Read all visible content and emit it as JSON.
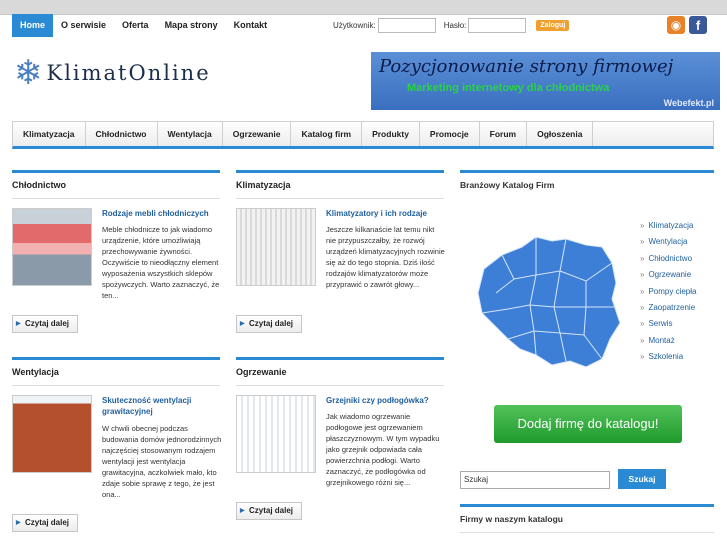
{
  "topnav": [
    {
      "label": "Home",
      "active": true
    },
    {
      "label": "O serwisie"
    },
    {
      "label": "Oferta"
    },
    {
      "label": "Mapa strony"
    },
    {
      "label": "Kontakt"
    }
  ],
  "login": {
    "user_label": "Użytkownik:",
    "pass_label": "Hasło:",
    "button": "Zaloguj"
  },
  "social": {
    "rss": "rss-icon",
    "facebook": "facebook-icon"
  },
  "logo": {
    "part1": "Klimat",
    "part2": "Online"
  },
  "banner": {
    "line1": "Pozycjonowanie strony firmowej",
    "line2": "Marketing internetowy dla chłodnictwa",
    "brand": "Webefekt.pl"
  },
  "mainnav": [
    "Klimatyzacja",
    "Chłodnictwo",
    "Wentylacja",
    "Ogrzewanie",
    "Katalog firm",
    "Produkty",
    "Promocje",
    "Forum",
    "Ogłoszenia"
  ],
  "sections": {
    "s1": {
      "heading": "Chłodnictwo",
      "title": "Rodzaje mebli chłodniczych",
      "text": "Meble chłodnicze to jak wiadomo urządzenie, które umożliwiają przechowywanie żywności. Oczywiście to nieodłączny element wyposażenia wszystkich sklepów spożywczych. Warto zaznaczyć, że ten...",
      "more": "Czytaj dalej"
    },
    "s2": {
      "heading": "Klimatyzacja",
      "title": "Klimatyzatory i ich rodzaje",
      "text": "Jeszcze kilkanaście lat temu nikt nie przypuszczałby, że rozwój urządzeń klimatyzacyjnych rozwinie się aż do tego stopnia. Dziś ilość rodzajów klimatyzatorów może przyprawić o zawrót głowy...",
      "more": "Czytaj dalej"
    },
    "s3": {
      "heading": "Wentylacja",
      "title": "Skuteczność wentylacji grawitacyjnej",
      "text": "W chwili obecnej podczas budowania domów jednorodzinnych najczęściej stosowanym rodzajem wentylacji jest wentylacja grawitacyjna, aczkolwiek mało, kto zdaje sobie sprawę z tego, że jest ona...",
      "more": "Czytaj dalej"
    },
    "s4": {
      "heading": "Ogrzewanie",
      "title": "Grzejniki czy podłogówka?",
      "text": "Jak wiadomo ogrzewanie podłogowe jest ogrzewaniem płaszczyznowym. W tym wypadku jako grzejnik odpowiada cała powierzchnia podłogi. Warto zaznaczyć, że podłogówka od grzejnikowego różni się...",
      "more": "Czytaj dalej"
    }
  },
  "catalog": {
    "heading": "Branżowy Katalog Firm",
    "items": [
      "Klimatyzacja",
      "Wentylacja",
      "Chłodnictwo",
      "Ogrzewanie",
      "Pompy ciepła",
      "Zaopatrzenie",
      "Serwis",
      "Montaż",
      "Szkolenia"
    ],
    "add_button": "Dodaj firmę do katalogu!",
    "search_placeholder": "Szukaj",
    "search_button": "Szukaj",
    "firms_heading": "Firmy w naszym katalogu"
  },
  "colors": {
    "accent": "#2b8ad4",
    "link": "#1f5f9e",
    "map": "#3d7fd6"
  }
}
